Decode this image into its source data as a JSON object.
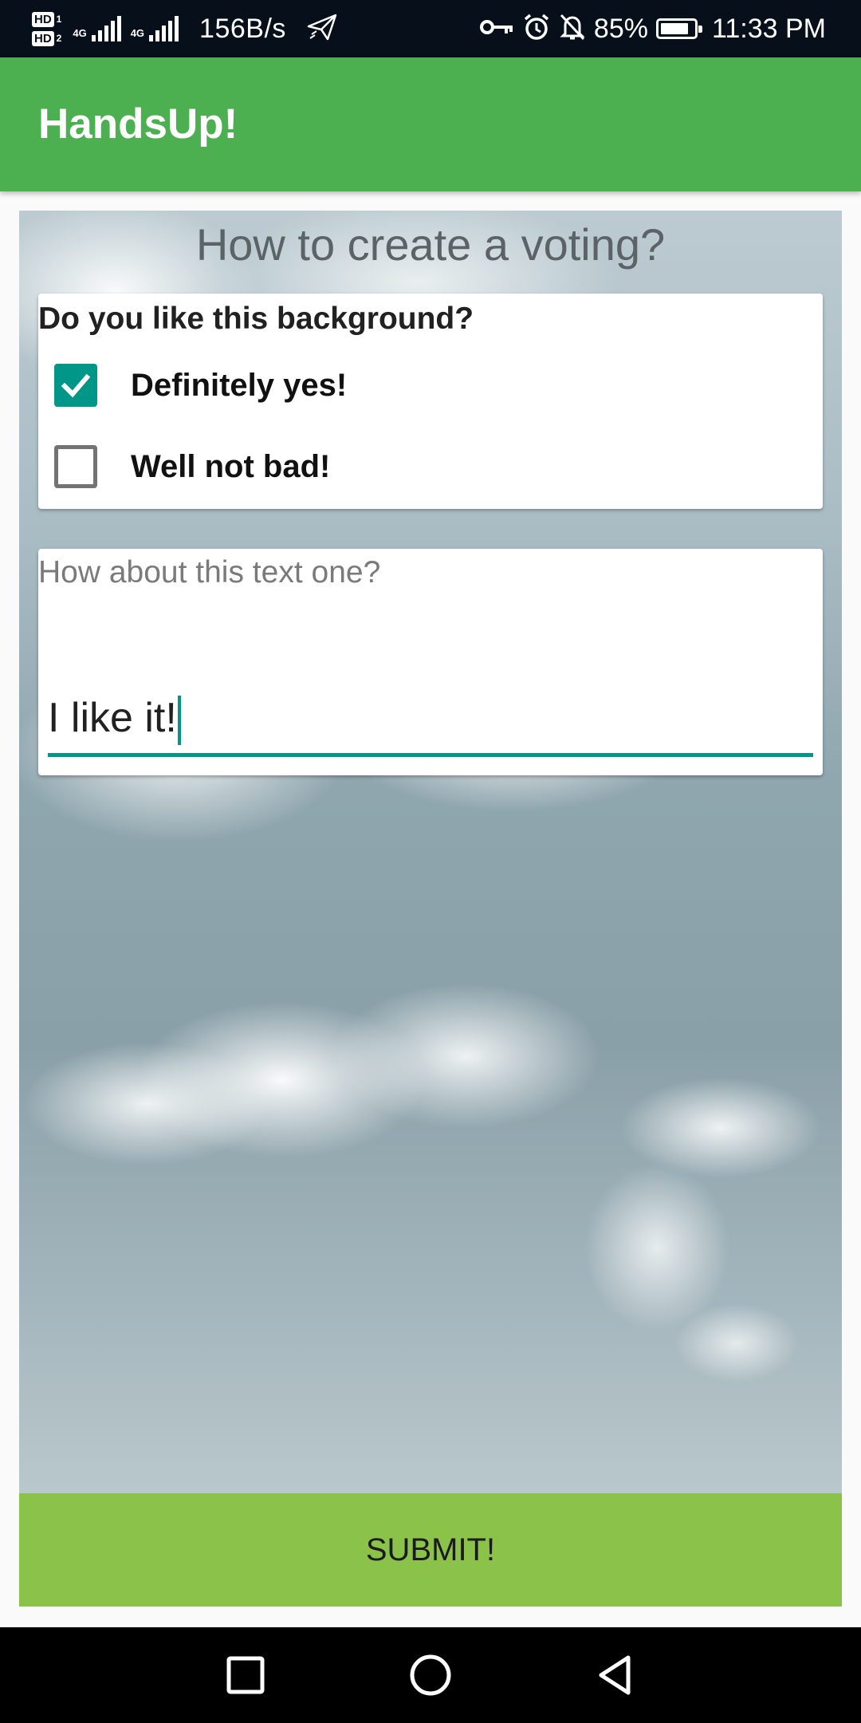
{
  "status_bar": {
    "hd1": "HD",
    "hd1_sim": "1",
    "hd2": "HD",
    "hd2_sim": "2",
    "sim1_network": "4G",
    "sim2_network": "4G",
    "net_speed": "156B/s",
    "battery": "85%",
    "battery_level": 0.85,
    "time": "11:33 PM",
    "icons": [
      "vpn-key-icon",
      "alarm-icon",
      "notifications-off-icon",
      "battery-icon",
      "send-icon"
    ]
  },
  "app_bar": {
    "title": "HandsUp!"
  },
  "voting": {
    "title": "How to create a voting?",
    "question1": {
      "label": "Do you like this background?",
      "options": [
        {
          "label": "Definitely yes!",
          "checked": true
        },
        {
          "label": "Well not bad!",
          "checked": false
        }
      ]
    },
    "question2": {
      "label": "How about this text one?",
      "answer": "I like it!"
    }
  },
  "submit_label": "SUBMIT!",
  "colors": {
    "app_bar": "#4caf50",
    "accent": "#009688",
    "submit": "#8bc34a"
  },
  "nav_bar": {
    "icons": [
      "recent-apps-icon",
      "home-icon",
      "back-icon"
    ]
  }
}
